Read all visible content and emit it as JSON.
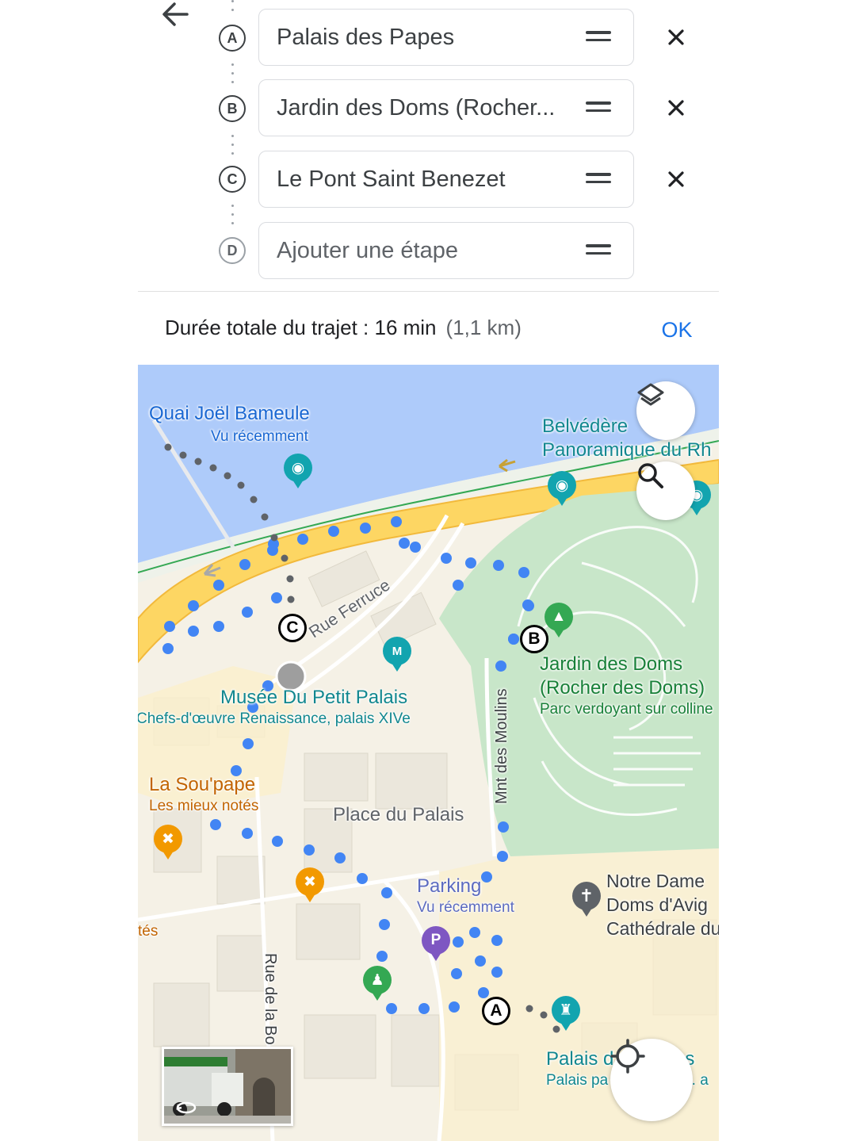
{
  "route": {
    "stops": [
      {
        "letter": "A",
        "name": "Palais des Papes"
      },
      {
        "letter": "B",
        "name": "Jardin des Doms (Rocher..."
      },
      {
        "letter": "C",
        "name": "Le Pont Saint Benezet"
      },
      {
        "letter": "D",
        "placeholder": "Ajouter une étape"
      }
    ]
  },
  "summary": {
    "duration_text": "Durée totale du trajet : 16 min",
    "distance_text": "(1,1 km)",
    "ok_label": "OK"
  },
  "map": {
    "labels": {
      "quai_title": "Quai Joël Bameule",
      "quai_sub": "Vu récemment",
      "belvedere_line1": "Belvédère",
      "belvedere_line2": "Panoramique du Rh",
      "rue_ferruce": "Rue Ferruce",
      "musee_title": "Musée Du Petit Palais",
      "musee_sub": "Chefs-d'œuvre Renaissance, palais XIVe",
      "jardin_line1": "Jardin des Doms",
      "jardin_line2": "(Rocher des Doms)",
      "jardin_sub": "Parc verdoyant sur colline",
      "mnt_moulins": "Mnt des Moulins",
      "sou_pape_title": "La Sou'pape",
      "sou_pape_sub": "Les mieux notés",
      "place_palais": "Place du Palais",
      "parking_title": "Parking",
      "parking_sub": "Vu récemment",
      "notre_dame_line1": "Notre Dame",
      "notre_dame_line2": "Doms d'Avig",
      "notre_dame_sub": "Cathédrale du X",
      "tes_fragment": "tés",
      "rue_bo": "Rue de la Bo",
      "palais_title_a": "Palais d",
      "palais_title_b": "s",
      "palais_sub_a": "Palais pa",
      "palais_sub_b": "s. a"
    },
    "markers": {
      "a": "A",
      "b": "B",
      "c": "C"
    },
    "icons": {
      "back": "arrow-left-icon",
      "remove": "close-icon",
      "drag": "drag-handle-icon",
      "layers": "layers-icon",
      "search": "search-icon",
      "locate": "my-location-icon",
      "camera": "camera-icon",
      "tree": "tree-icon",
      "museum": "museum-icon",
      "restaurant": "restaurant-icon",
      "parking": "parking-icon",
      "hiker": "hiker-icon",
      "church": "church-icon",
      "castle": "castle-icon",
      "street_view": "street-view-rotate-icon"
    },
    "colors": {
      "water": "#aecbfa",
      "road_major": "#fdd663",
      "park": "#c8e6c9",
      "route_dots": "#4285f4",
      "walk_dots": "#5f6368",
      "accent": "#1a73e8"
    }
  }
}
